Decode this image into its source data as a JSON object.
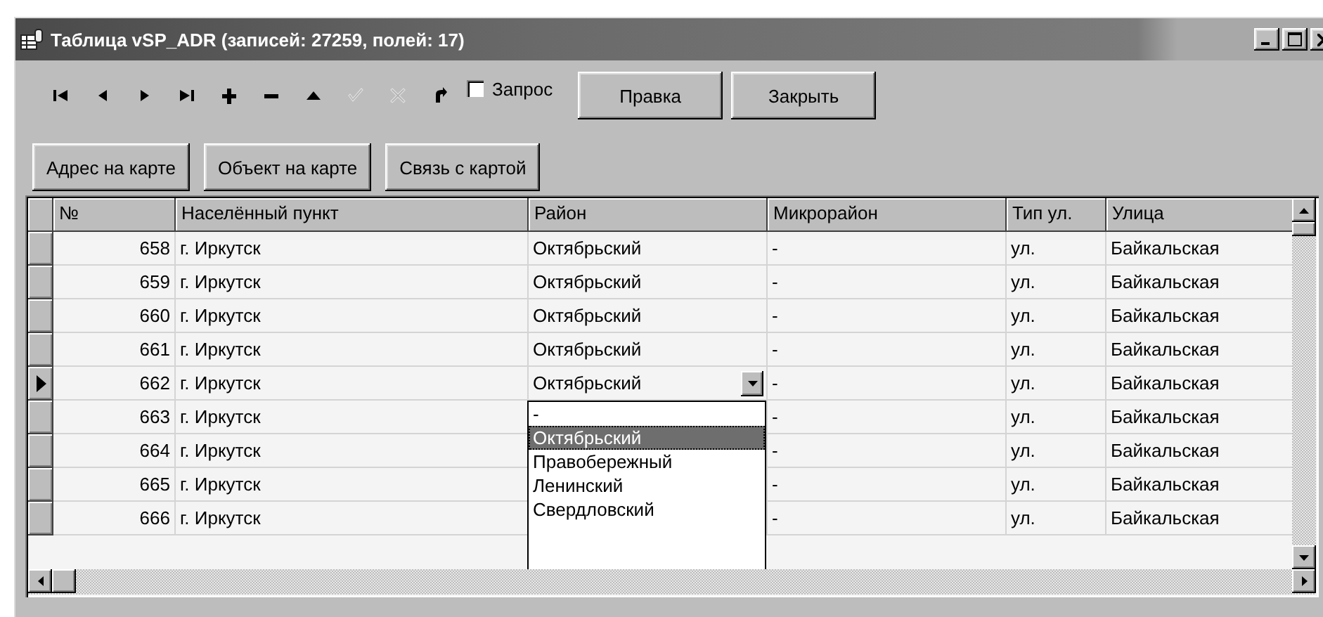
{
  "window": {
    "title": "Таблица vSP_ADR (записей: 27259, полей: 17)"
  },
  "navigator": [
    {
      "kind": "first",
      "disabled": false
    },
    {
      "kind": "prior",
      "disabled": false
    },
    {
      "kind": "next",
      "disabled": false
    },
    {
      "kind": "last",
      "disabled": false
    },
    {
      "kind": "insert",
      "disabled": false
    },
    {
      "kind": "delete",
      "disabled": false
    },
    {
      "kind": "edit",
      "disabled": false
    },
    {
      "kind": "post",
      "disabled": true
    },
    {
      "kind": "cancel",
      "disabled": true
    },
    {
      "kind": "refresh",
      "disabled": false
    }
  ],
  "query_checkbox": {
    "label": "Запрос",
    "checked": false
  },
  "buttons": [
    "Правка",
    "Закрыть"
  ],
  "map_buttons": [
    "Адрес на карте",
    "Объект на карте",
    "Связь с картой"
  ],
  "table": {
    "columns": [
      "№",
      "Населённый пункт",
      "Район",
      "Микрорайон",
      "Тип ул.",
      "Улица"
    ],
    "rows": [
      {
        "number": "658",
        "locality": "г. Иркутск",
        "district": "Октябрьский",
        "microdistrict": "-",
        "street_type": "ул.",
        "street": "Байкальская",
        "selected": false,
        "editing": false
      },
      {
        "number": "659",
        "locality": "г. Иркутск",
        "district": "Октябрьский",
        "microdistrict": "-",
        "street_type": "ул.",
        "street": "Байкальская",
        "selected": false,
        "editing": false
      },
      {
        "number": "660",
        "locality": "г. Иркутск",
        "district": "Октябрьский",
        "microdistrict": "-",
        "street_type": "ул.",
        "street": "Байкальская",
        "selected": false,
        "editing": false
      },
      {
        "number": "661",
        "locality": "г. Иркутск",
        "district": "Октябрьский",
        "microdistrict": "-",
        "street_type": "ул.",
        "street": "Байкальская",
        "selected": false,
        "editing": false
      },
      {
        "number": "662",
        "locality": "г. Иркутск",
        "district": "Октябрьский",
        "microdistrict": "-",
        "street_type": "ул.",
        "street": "Байкальская",
        "selected": true,
        "editing": true
      },
      {
        "number": "663",
        "locality": "г. Иркутск",
        "microdistrict": "-",
        "street_type": "ул.",
        "street": "Байкальская",
        "selected": false,
        "editing": false
      },
      {
        "number": "664",
        "locality": "г. Иркутск",
        "microdistrict": "-",
        "street_type": "ул.",
        "street": "Байкальская",
        "selected": false,
        "editing": false
      },
      {
        "number": "665",
        "locality": "г. Иркутск",
        "microdistrict": "-",
        "street_type": "ул.",
        "street": "Байкальская",
        "selected": false,
        "editing": false
      },
      {
        "number": "666",
        "locality": "г. Иркутск",
        "microdistrict": "-",
        "street_type": "ул.",
        "street": "Байкальская",
        "selected": false,
        "editing": false
      }
    ],
    "dropdown": {
      "options": [
        {
          "label": "-",
          "selected": false
        },
        {
          "label": "Октябрьский",
          "selected": true
        },
        {
          "label": "Правобережный",
          "selected": false
        },
        {
          "label": "Ленинский",
          "selected": false
        },
        {
          "label": "Свердловский",
          "selected": false
        }
      ]
    }
  }
}
